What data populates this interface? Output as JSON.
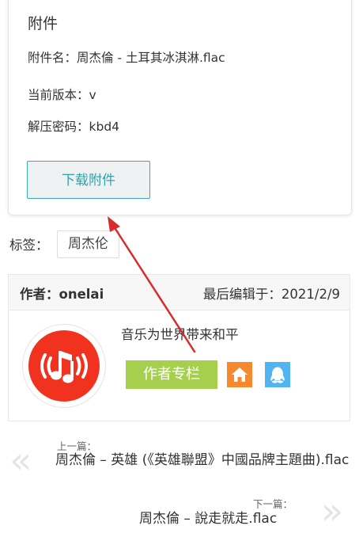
{
  "attachment": {
    "title": "附件",
    "name_line": "附件名：周杰倫 - 土耳其冰淇淋.flac",
    "version_line": "当前版本：v",
    "password_line": "解压密码：kbd4",
    "download_label": "下载附件"
  },
  "tags": {
    "label": "标签：",
    "items": [
      "周杰伦"
    ]
  },
  "author": {
    "label": "作者：onelai",
    "last_edit": "最后编辑于：2021/2/9",
    "motto": "音乐为世界带来和平",
    "column_label": "作者专栏",
    "avatar_icon": "music-note-icon",
    "home_icon": "home-icon",
    "qq_icon": "qq-icon",
    "colors": {
      "avatar": "#f0321e",
      "column_button": "#a5cf4c",
      "home_button": "#f5892e",
      "qq_button": "#4fb4ef"
    }
  },
  "navigation": {
    "prev_tag": "上一篇：",
    "prev_title": "周杰倫 – 英雄 (《英雄聯盟》中國品牌主題曲).flac",
    "next_tag": "下一篇：",
    "next_title": "周杰倫 – 說走就走.flac",
    "prev_glyph": "«",
    "next_glyph": "»"
  },
  "colors": {
    "accent": "#2ea3ad",
    "annotation": "#d92b2b"
  }
}
